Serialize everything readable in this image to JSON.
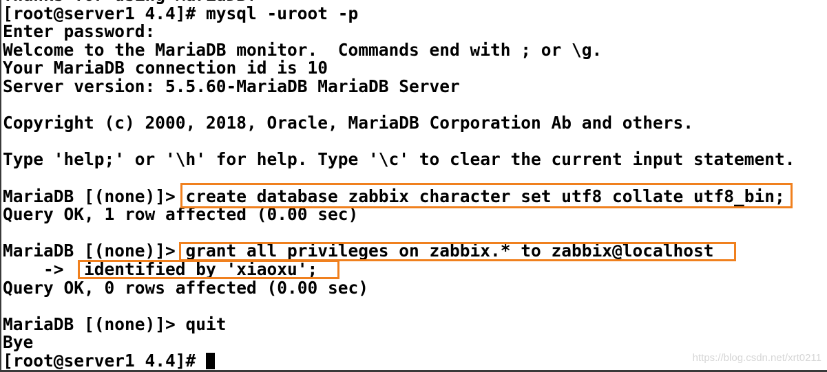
{
  "terminal": {
    "lines": [
      "Thanks for using MariaDB!",
      "[root@server1 4.4]# mysql -uroot -p",
      "Enter password:",
      "Welcome to the MariaDB monitor.  Commands end with ; or \\g.",
      "Your MariaDB connection id is 10",
      "Server version: 5.5.60-MariaDB MariaDB Server",
      "",
      "Copyright (c) 2000, 2018, Oracle, MariaDB Corporation Ab and others.",
      "",
      "Type 'help;' or '\\h' for help. Type '\\c' to clear the current input statement.",
      "",
      "MariaDB [(none)]> create database zabbix character set utf8 collate utf8_bin;",
      "Query OK, 1 row affected (0.00 sec)",
      "",
      "MariaDB [(none)]> grant all privileges on zabbix.* to zabbix@localhost",
      "    ->  identified by 'xiaoxu';",
      "Query OK, 0 rows affected (0.00 sec)",
      "",
      "MariaDB [(none)]> quit",
      "Bye",
      "[root@server1 4.4]# "
    ],
    "highlight_color": "#f0801e"
  },
  "watermark": "https://blog.csdn.net/xrt0211"
}
